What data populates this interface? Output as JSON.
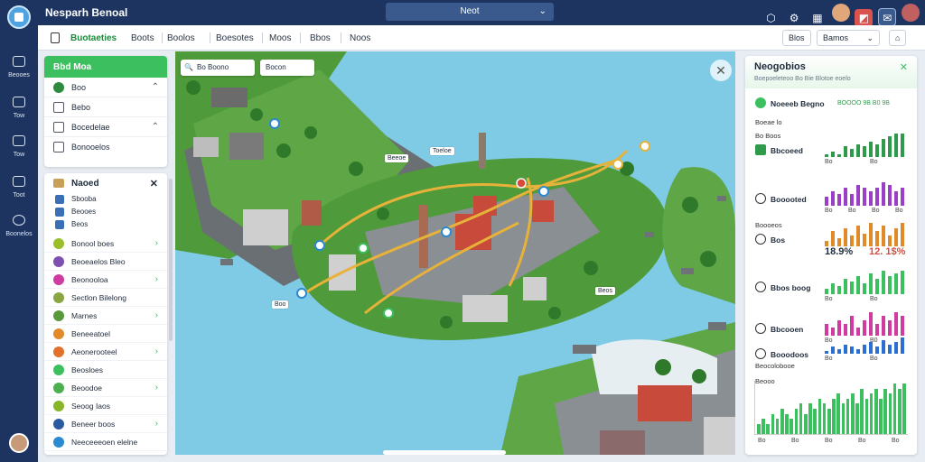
{
  "app": {
    "title": "Nesparh Benoal",
    "top_select": "Neot",
    "colors": {
      "navy": "#1d3461",
      "accent": "#3cbf5f",
      "water": "#7fcbe6"
    }
  },
  "rail": [
    {
      "label": "Beooes",
      "icon": "pin-icon"
    },
    {
      "label": "Tow",
      "icon": "layers-icon"
    },
    {
      "label": "Tow",
      "icon": "monitor-icon"
    },
    {
      "label": "Toot",
      "icon": "screen-icon"
    },
    {
      "label": "Boonelos",
      "icon": "globe-icon"
    }
  ],
  "tabs": [
    {
      "label": "Buotaeties",
      "active": true
    },
    {
      "label": "Boots"
    },
    {
      "label": "Boolos"
    },
    {
      "label": "Boesotes"
    },
    {
      "label": "Moos"
    },
    {
      "label": "Bbos"
    },
    {
      "label": "Noos"
    }
  ],
  "toolbar": {
    "left_btn": "Blos",
    "select": "Bamos",
    "right_btn": "⌂"
  },
  "sidebar_top": {
    "header": "Bbd Moa",
    "items": [
      {
        "label": "Boo",
        "color": "#2e8b3d"
      },
      {
        "label": "Bebo",
        "color": "#888"
      },
      {
        "label": "Bocedelae",
        "color": "#888"
      },
      {
        "label": "Bonooelos",
        "color": "#888"
      }
    ]
  },
  "sidebar_layers": {
    "header": "Naoed",
    "sub": [
      {
        "label": "Sbooba",
        "color": "#3a6fb5"
      },
      {
        "label": "Beooes",
        "color": "#3a6fb5"
      },
      {
        "label": "Beos",
        "color": "#3a6fb5"
      }
    ],
    "items": [
      {
        "label": "Bonool boes",
        "color": "#9bbf2a"
      },
      {
        "label": "Beoeaelos Bleo",
        "color": "#7d4fb0"
      },
      {
        "label": "Beonooloa",
        "color": "#cf3b9e"
      },
      {
        "label": "Sectlon Bilelong",
        "color": "#8aa642"
      },
      {
        "label": "Marnes",
        "color": "#58983a"
      },
      {
        "label": "Beneeatoel",
        "color": "#e08a2a"
      },
      {
        "label": "Aeonerooteel",
        "color": "#e0702a"
      },
      {
        "label": "Beosloes",
        "color": "#3cbf5f"
      },
      {
        "label": "Beoodoe",
        "color": "#4caf50"
      },
      {
        "label": "Seoog Iaos",
        "color": "#88b62a"
      },
      {
        "label": "Beneer boos",
        "color": "#2c5aa0"
      },
      {
        "label": "Neeceeeoen elelne",
        "color": "#2c8ad0"
      }
    ]
  },
  "map": {
    "search": "Bo Boono",
    "filter": "Bocon",
    "labels": [
      "Beeoe",
      "Toeloe",
      "Boo",
      "Beos"
    ]
  },
  "right": {
    "title": "Neogobios",
    "subtitle": "Boepoeleteoo Bo Bie Blotoe eoelo",
    "section_title": "Noeeeb Begno",
    "section_values": "BOOOO 9B B0 9B",
    "rows_label": "Boeae lo",
    "sections": [
      {
        "name": "Bbcoeed",
        "small": "Bo Boos",
        "color": "#2e9b4a",
        "ticks": [
          "Bo",
          "Bo"
        ],
        "values": [
          1,
          2,
          1,
          4,
          3,
          5,
          4,
          6,
          5,
          7,
          8,
          9,
          9
        ]
      },
      {
        "name": "Booooted",
        "color": "#9b3fc8",
        "ticks": [
          "Bo",
          "Bo",
          "Bo",
          "Bo"
        ],
        "values": [
          3,
          5,
          4,
          6,
          4,
          7,
          6,
          5,
          6,
          8,
          7,
          5,
          6
        ]
      },
      {
        "name": "Bos",
        "small": "Boooeos",
        "color": "#e08a2a",
        "big_left": "18.9%",
        "big_right": "12. 1$%",
        "values": [
          2,
          6,
          3,
          7,
          4,
          8,
          5,
          9,
          6,
          8,
          4,
          7,
          9
        ]
      },
      {
        "name": "Bbos boog",
        "color": "#3cbf5f",
        "ticks": [
          "Bo",
          "Bo"
        ],
        "values": [
          2,
          4,
          3,
          6,
          5,
          7,
          4,
          8,
          6,
          9,
          7,
          8,
          9
        ]
      },
      {
        "name": "Bbcooen",
        "color": "#cf3b9e",
        "ticks": [
          "Bo",
          "B0"
        ],
        "values": [
          3,
          2,
          4,
          3,
          5,
          2,
          4,
          6,
          3,
          5,
          4,
          6,
          5
        ]
      },
      {
        "name": "Booodoos",
        "color": "#2c6fd0",
        "ticks": [
          "Bo",
          "Bo"
        ],
        "values": [
          1,
          3,
          2,
          4,
          3,
          2,
          4,
          5,
          3,
          6,
          4,
          5,
          7
        ]
      }
    ],
    "bottom_label_1": "Beocolobooe",
    "bottom_label_2": "Beooo",
    "bottom_ticks": [
      "Bo",
      "Bo",
      "Bo",
      "Bo",
      "Bo"
    ],
    "bottom_values": [
      2,
      3,
      2,
      4,
      3,
      5,
      4,
      3,
      5,
      6,
      4,
      6,
      5,
      7,
      6,
      5,
      7,
      8,
      6,
      7,
      8,
      6,
      9,
      7,
      8,
      9,
      7,
      9,
      8,
      10,
      9,
      10
    ]
  }
}
